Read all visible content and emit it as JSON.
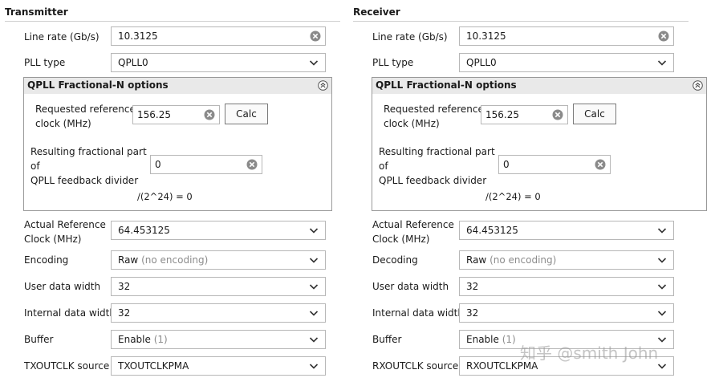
{
  "transmitter": {
    "title": "Transmitter",
    "line_rate": {
      "label": "Line rate (Gb/s)",
      "value": "10.3125"
    },
    "pll_type": {
      "label": "PLL type",
      "value": "QPLL0"
    },
    "qpll": {
      "title": "QPLL Fractional-N options",
      "ref_clock_label_1": "Requested reference",
      "ref_clock_label_2": "clock (MHz)",
      "ref_clock_value": "156.25",
      "calc_label": "Calc",
      "frac_label_1": "Resulting fractional part",
      "frac_label_2": "of",
      "frac_label_3": "QPLL feedback divider",
      "frac_value": "0",
      "formula": "/(2^24) = 0"
    },
    "actual_ref": {
      "label_1": "Actual Reference",
      "label_2": "Clock (MHz)",
      "value": "64.453125"
    },
    "encoding": {
      "label": "Encoding",
      "value": "Raw",
      "hint": "(no encoding)"
    },
    "user_width": {
      "label": "User data width",
      "value": "32"
    },
    "internal_width": {
      "label": "Internal data width",
      "value": "32"
    },
    "buffer": {
      "label": "Buffer",
      "value": "Enable",
      "hint": "(1)"
    },
    "outclk": {
      "label": "TXOUTCLK source",
      "value": "TXOUTCLKPMA"
    }
  },
  "receiver": {
    "title": "Receiver",
    "line_rate": {
      "label": "Line rate (Gb/s)",
      "value": "10.3125"
    },
    "pll_type": {
      "label": "PLL type",
      "value": "QPLL0"
    },
    "qpll": {
      "title": "QPLL Fractional-N options",
      "ref_clock_label_1": "Requested reference",
      "ref_clock_label_2": "clock (MHz)",
      "ref_clock_value": "156.25",
      "calc_label": "Calc",
      "frac_label_1": "Resulting fractional part",
      "frac_label_2": "of",
      "frac_label_3": "QPLL feedback divider",
      "frac_value": "0",
      "formula": "/(2^24) = 0"
    },
    "actual_ref": {
      "label_1": "Actual Reference",
      "label_2": "Clock (MHz)",
      "value": "64.453125"
    },
    "encoding": {
      "label": "Decoding",
      "value": "Raw",
      "hint": "(no encoding)"
    },
    "user_width": {
      "label": "User data width",
      "value": "32"
    },
    "internal_width": {
      "label": "Internal data width",
      "value": "32"
    },
    "buffer": {
      "label": "Buffer",
      "value": "Enable",
      "hint": "(1)"
    },
    "outclk": {
      "label": "RXOUTCLK source",
      "value": "RXOUTCLKPMA"
    }
  },
  "watermark": "知乎 @smith John",
  "icons": {
    "clear": "clear-icon",
    "dropdown": "chevron-down-icon",
    "collapse": "collapse-up-icon"
  }
}
